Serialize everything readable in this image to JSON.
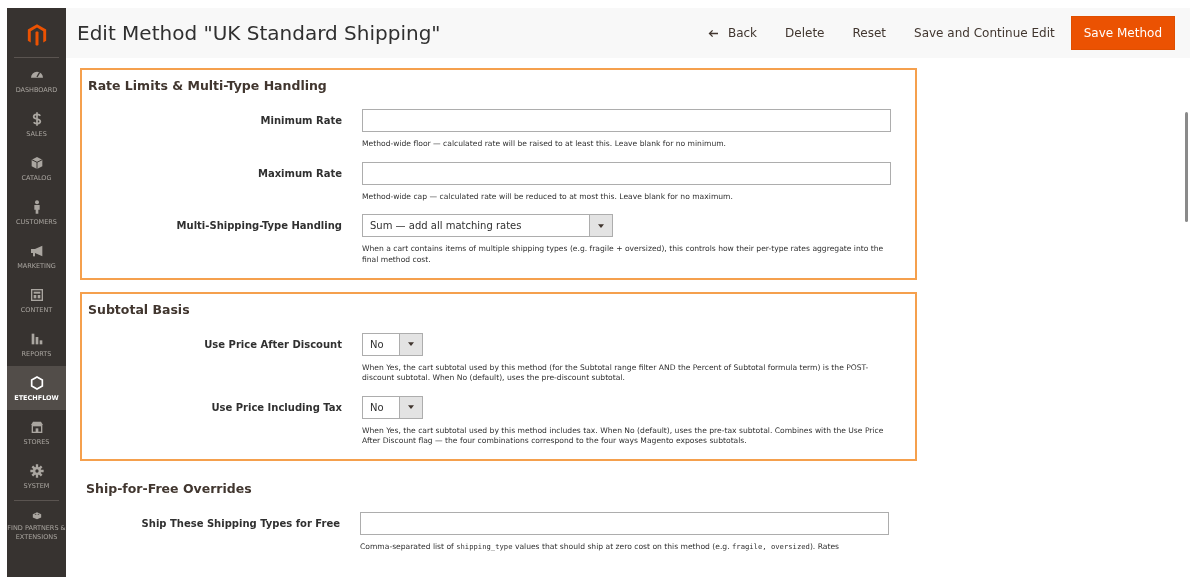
{
  "sidebar": {
    "items": [
      {
        "label": "DASHBOARD",
        "selected": false
      },
      {
        "label": "SALES",
        "selected": false
      },
      {
        "label": "CATALOG",
        "selected": false
      },
      {
        "label": "CUSTOMERS",
        "selected": false
      },
      {
        "label": "MARKETING",
        "selected": false
      },
      {
        "label": "CONTENT",
        "selected": false
      },
      {
        "label": "REPORTS",
        "selected": false
      },
      {
        "label": "ETECHFLOW",
        "selected": true
      },
      {
        "label": "STORES",
        "selected": false
      },
      {
        "label": "SYSTEM",
        "selected": false
      },
      {
        "label": "FIND PARTNERS & EXTENSIONS",
        "selected": false
      }
    ]
  },
  "header": {
    "title": "Edit Method \"UK Standard Shipping\"",
    "actions": [
      {
        "label": "Back",
        "kind": "back"
      },
      {
        "label": "Delete",
        "kind": "plain"
      },
      {
        "label": "Reset",
        "kind": "plain"
      },
      {
        "label": "Save and Continue Edit",
        "kind": "plain"
      },
      {
        "label": "Save Method",
        "kind": "primary"
      }
    ]
  },
  "sections": [
    {
      "title": "Rate Limits & Multi-Type Handling",
      "highlighted": true,
      "fields": [
        {
          "label": "Minimum Rate",
          "kind": "text",
          "help": [
            {
              "kind": "text",
              "text": "Method-wide floor — calculated rate will be raised to at least this. Leave blank for no minimum."
            }
          ]
        },
        {
          "label": "Maximum Rate",
          "kind": "text",
          "help": [
            {
              "kind": "text",
              "text": "Method-wide cap — calculated rate will be reduced to at most this. Leave blank for no maximum."
            }
          ]
        },
        {
          "label": "Multi-Shipping-Type Handling",
          "kind": "select-wide",
          "value": "Sum — add all matching rates",
          "help": [
            {
              "kind": "text",
              "text": "When a cart contains items of multiple shipping types (e.g. fragile + oversized), this controls how their per-type rates aggregate into the final method cost."
            }
          ]
        }
      ]
    },
    {
      "title": "Subtotal Basis",
      "highlighted": true,
      "fields": [
        {
          "label": "Use Price After Discount",
          "kind": "select-small",
          "value": "No",
          "help": [
            {
              "kind": "text",
              "text": "When Yes, the cart subtotal used by this method (for the Subtotal range filter AND the Percent of Subtotal formula term) is the POST-discount subtotal. When No (default), uses the pre-discount subtotal."
            }
          ]
        },
        {
          "label": "Use Price Including Tax",
          "kind": "select-small",
          "value": "No",
          "help": [
            {
              "kind": "text",
              "text": "When Yes, the cart subtotal used by this method includes tax. When No (default), uses the pre-tax subtotal. Combines with the Use Price After Discount flag — the four combinations correspond to the four ways Magento exposes subtotals."
            }
          ]
        }
      ]
    },
    {
      "title": "Ship-for-Free Overrides",
      "highlighted": false,
      "fields": [
        {
          "label": "Ship These Shipping Types for Free",
          "kind": "text",
          "help": [
            {
              "kind": "text",
              "text": "Comma-separated list of "
            },
            {
              "kind": "code",
              "text": "shipping_type"
            },
            {
              "kind": "text",
              "text": " values that should ship at zero cost on this method (e.g. "
            },
            {
              "kind": "code",
              "text": "fragile, oversized"
            },
            {
              "kind": "text",
              "text": "). Rates"
            }
          ]
        }
      ]
    }
  ]
}
